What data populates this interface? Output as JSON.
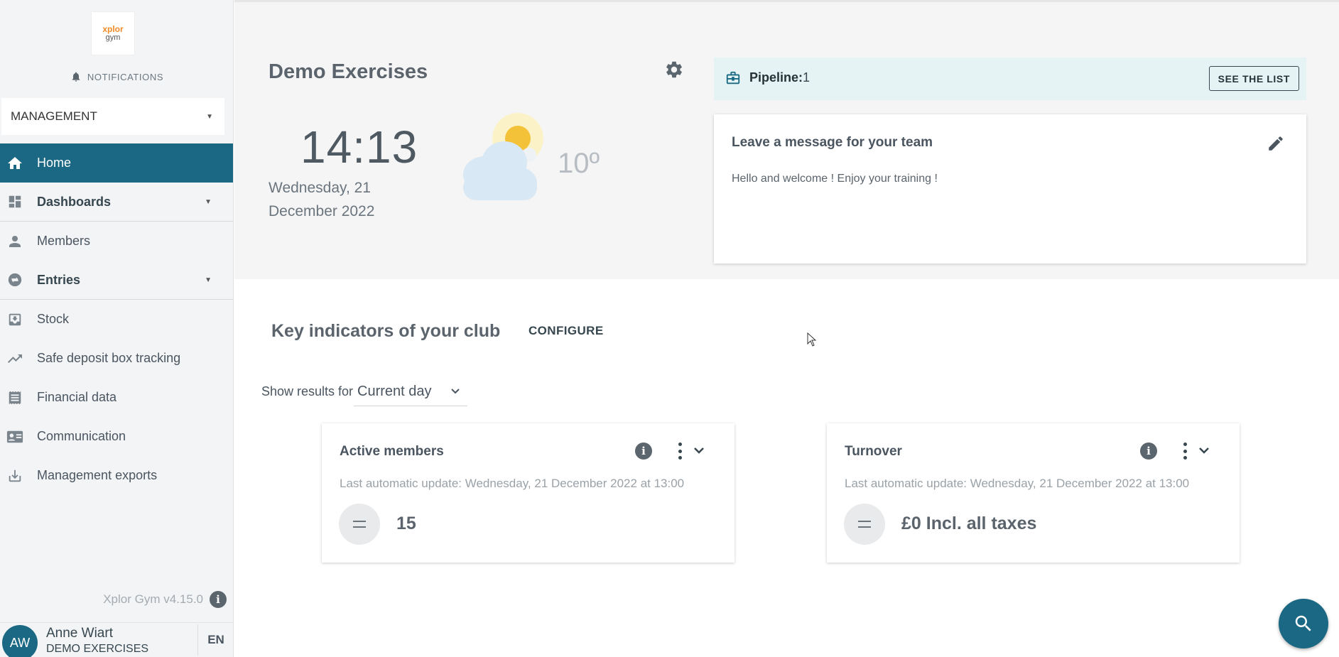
{
  "sidebar": {
    "logo_line1": "xplor",
    "logo_line2": "gym",
    "notifications_label": "NOTIFICATIONS",
    "section_select": "MANAGEMENT",
    "items": [
      {
        "label": "Home",
        "icon": "home-icon"
      },
      {
        "label": "Dashboards",
        "icon": "dashboard-icon"
      },
      {
        "label": "Members",
        "icon": "person-icon"
      },
      {
        "label": "Entries",
        "icon": "entries-icon"
      },
      {
        "label": "Stock",
        "icon": "stock-icon"
      },
      {
        "label": "Safe deposit box tracking",
        "icon": "trending-icon"
      },
      {
        "label": "Financial data",
        "icon": "receipt-icon"
      },
      {
        "label": "Communication",
        "icon": "contact-card-icon"
      },
      {
        "label": "Management exports",
        "icon": "download-icon"
      }
    ],
    "version": "Xplor Gym v4.15.0",
    "user": {
      "initials": "AW",
      "name": "Anne Wiart",
      "club": "DEMO EXERCISES",
      "language": "EN"
    }
  },
  "header": {
    "club_name": "Demo Exercises",
    "time": "14:13",
    "date_line1": "Wednesday, 21",
    "date_line2": "December 2022",
    "temperature": "10º",
    "weather_icon": "partly-cloudy-icon"
  },
  "pipeline": {
    "label": "Pipeline:",
    "count": "1",
    "button": "SEE THE LIST"
  },
  "message": {
    "title": "Leave a message for your team",
    "body": "Hello and welcome ! Enjoy your training !"
  },
  "indicators": {
    "title": "Key indicators of your club",
    "configure": "CONFIGURE",
    "show_results_label": "Show results for",
    "period": "Current day",
    "cards": [
      {
        "title": "Active members",
        "update": "Last automatic update: Wednesday, 21 December 2022 at 13:00",
        "value": "15"
      },
      {
        "title": "Turnover",
        "update": "Last automatic update: Wednesday, 21 December 2022 at 13:00",
        "value": "£0 Incl. all taxes"
      }
    ]
  },
  "colors": {
    "accent": "#1a6884",
    "pipeline_bg": "#e5f3f5",
    "hero_bg": "#f5f5f6"
  }
}
